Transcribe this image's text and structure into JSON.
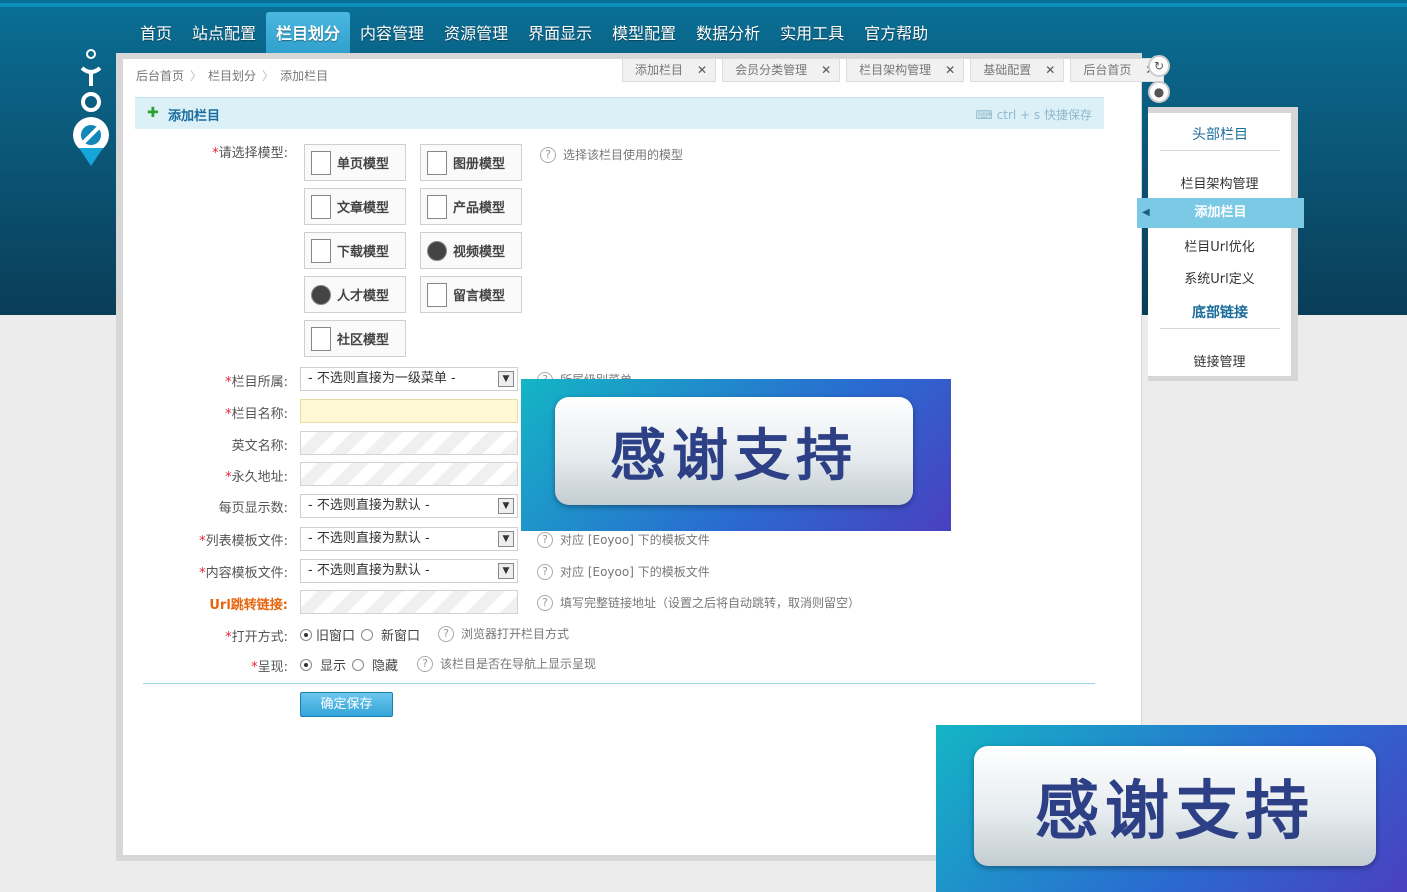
{
  "nav": [
    "首页",
    "站点配置",
    "栏目划分",
    "内容管理",
    "资源管理",
    "界面显示",
    "模型配置",
    "数据分析",
    "实用工具",
    "官方帮助"
  ],
  "nav_active": "栏目划分",
  "breadcrumb": [
    "后台首页",
    "栏目划分",
    "添加栏目"
  ],
  "tabs": [
    "添加栏目",
    "会员分类管理",
    "栏目架构管理",
    "基础配置",
    "后台首页"
  ],
  "title": {
    "plus": "✚",
    "text": "添加栏目",
    "hint": "ctrl + s 快捷保存"
  },
  "form": {
    "model_label": "请选择模型:",
    "models": [
      "单页模型",
      "图册模型",
      "文章模型",
      "产品模型",
      "下载模型",
      "视频模型",
      "人才模型",
      "留言模型",
      "社区模型"
    ],
    "model_help": "选择该栏目使用的模型",
    "parent_label": "栏目所属:",
    "parent_value": "- 不选则直接为一级菜单 -",
    "parent_help": "所属级别菜单",
    "name_label": "栏目名称:",
    "en_label": "英文名称:",
    "url_label": "永久地址:",
    "perpage_label": "每页显示数:",
    "perpage_value": "- 不选则直接为默认 -",
    "list_tpl_label": "列表模板文件:",
    "list_tpl_value": "- 不选则直接为默认 -",
    "list_tpl_help": "对应 [Eoyoo] 下的模板文件",
    "content_tpl_label": "内容模板文件:",
    "content_tpl_value": "- 不选则直接为默认 -",
    "content_tpl_help": "对应 [Eoyoo] 下的模板文件",
    "jump_label": "Url跳转链接:",
    "jump_help": "填写完整链接地址（设置之后将自动跳转，取消则留空）",
    "open_label": "打开方式:",
    "open_options": [
      "旧窗口",
      "新窗口"
    ],
    "open_help": "浏览器打开栏目方式",
    "show_label": "呈现:",
    "show_options": [
      "显示",
      "隐藏"
    ],
    "show_help": "该栏目是否在导航上显示呈现",
    "save": "确定保存"
  },
  "sidebar": {
    "head": "头部栏目",
    "items": [
      "栏目架构管理",
      "添加栏目",
      "栏目Url优化",
      "系统Url定义"
    ],
    "active": "添加栏目",
    "foot": "底部链接",
    "foot_items": [
      "链接管理"
    ]
  },
  "banner_text": "感谢支持",
  "icons": [
    "refresh-icon",
    "user-icon",
    "help-icon",
    "keyboard-icon",
    "plus-icon",
    "close-icon",
    "dropdown-arrow-icon"
  ]
}
